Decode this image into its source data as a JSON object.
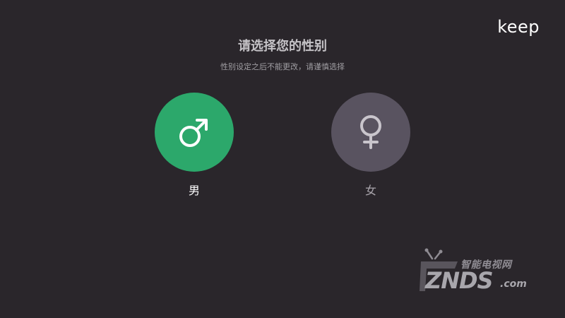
{
  "header": {
    "logo_text": "keep"
  },
  "prompt": {
    "title": "请选择您的性别",
    "subtitle": "性别设定之后不能更改，请谨慎选择"
  },
  "options": [
    {
      "label": "男",
      "icon": "male-symbol-icon",
      "color": "#2ca86b",
      "selected": true
    },
    {
      "label": "女",
      "icon": "female-symbol-icon",
      "color": "#595360",
      "selected": false
    }
  ],
  "watermark": {
    "cn_text": "智能电视网",
    "en_text": "ZNDS",
    "suffix": ".com"
  }
}
